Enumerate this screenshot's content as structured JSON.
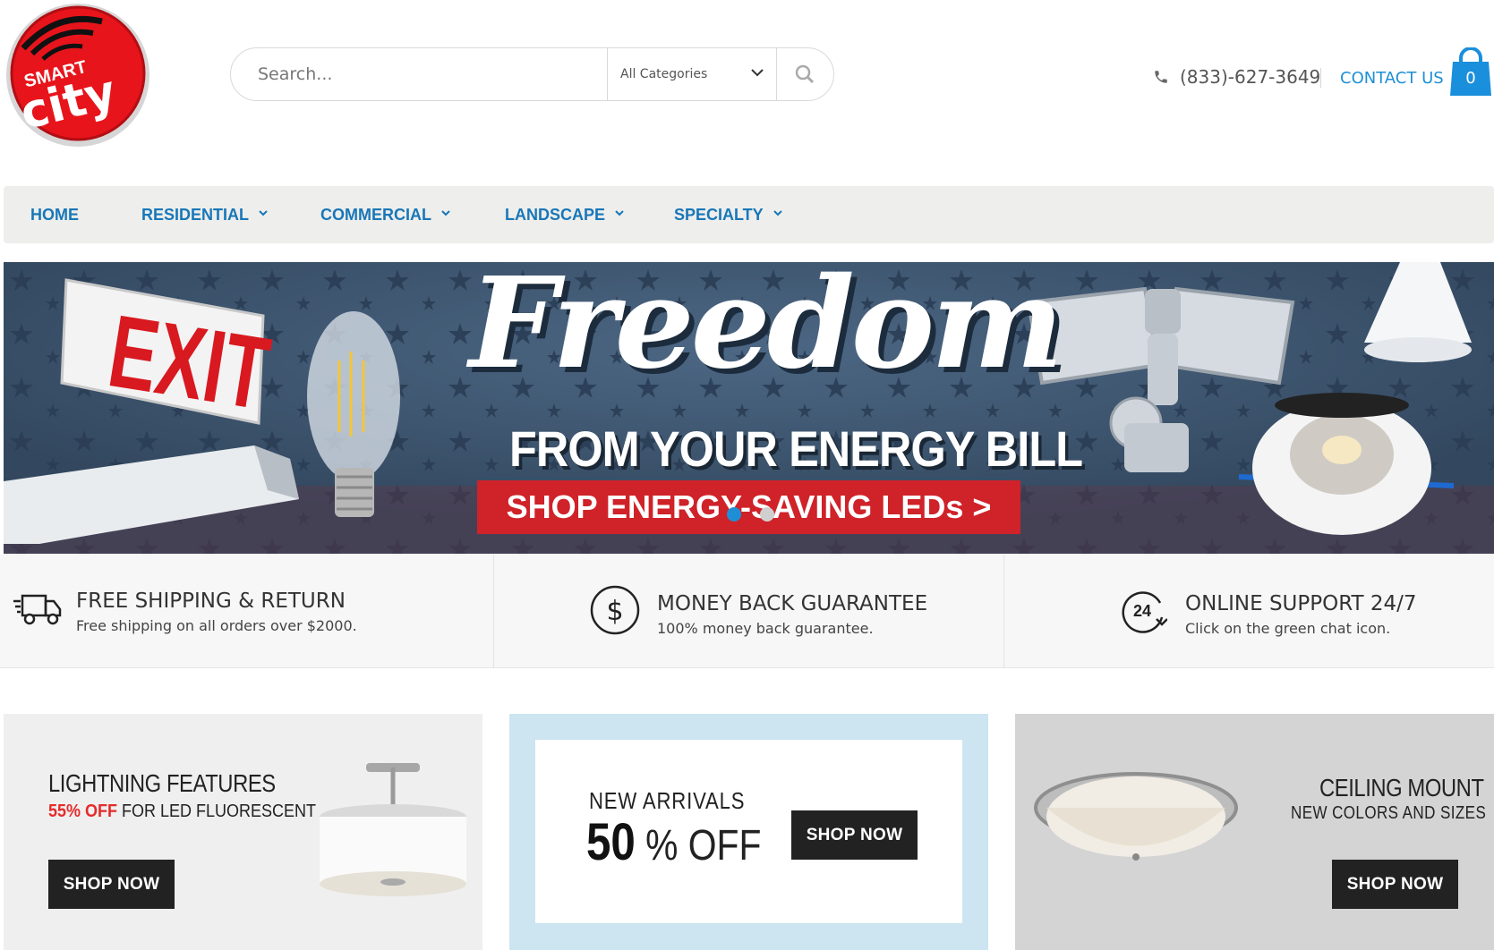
{
  "logo": {
    "top_text": "SMART",
    "main_text": "city"
  },
  "search": {
    "placeholder": "Search...",
    "category": "All Categories"
  },
  "header": {
    "phone": "(833)-627-3649",
    "contact": "CONTACT US",
    "cart_count": "0"
  },
  "nav": {
    "items": [
      {
        "label": "HOME"
      },
      {
        "label": "RESIDENTIAL"
      },
      {
        "label": "COMMERCIAL"
      },
      {
        "label": "LANDSCAPE"
      },
      {
        "label": "SPECIALTY"
      }
    ]
  },
  "hero": {
    "exit_sign": "EXIT",
    "title": "Freedom",
    "subtitle": "FROM YOUR ENERGY BILL",
    "cta": "SHOP ENERGY-SAVING LEDs >",
    "slides": 2,
    "active_slide": 1
  },
  "features": [
    {
      "title": "FREE SHIPPING & RETURN",
      "desc": "Free shipping on all orders over $2000.",
      "icon": "truck-icon"
    },
    {
      "title": "MONEY BACK GUARANTEE",
      "desc": "100% money back guarantee.",
      "icon": "dollar-icon"
    },
    {
      "title": "ONLINE SUPPORT 24/7",
      "desc": "Click on the green chat icon.",
      "icon": "support-24-icon"
    }
  ],
  "promos": [
    {
      "title": "LIGHTNING FEATURES",
      "highlight": "55% OFF",
      "rest": " FOR LED FLUORESCENT",
      "button": "SHOP NOW"
    },
    {
      "title": "NEW ARRIVALS",
      "big": "50",
      "suffix": " % OFF",
      "button": "SHOP NOW"
    },
    {
      "title": "CEILING MOUNT",
      "sub": "NEW COLORS AND SIZES",
      "button": "SHOP NOW"
    }
  ],
  "colors": {
    "accent": "#1e8fd6",
    "nav_text": "#1877b8",
    "hero_bg": "#3a5571",
    "cta_red": "#cf2229",
    "promo_red": "#e52b2b"
  }
}
